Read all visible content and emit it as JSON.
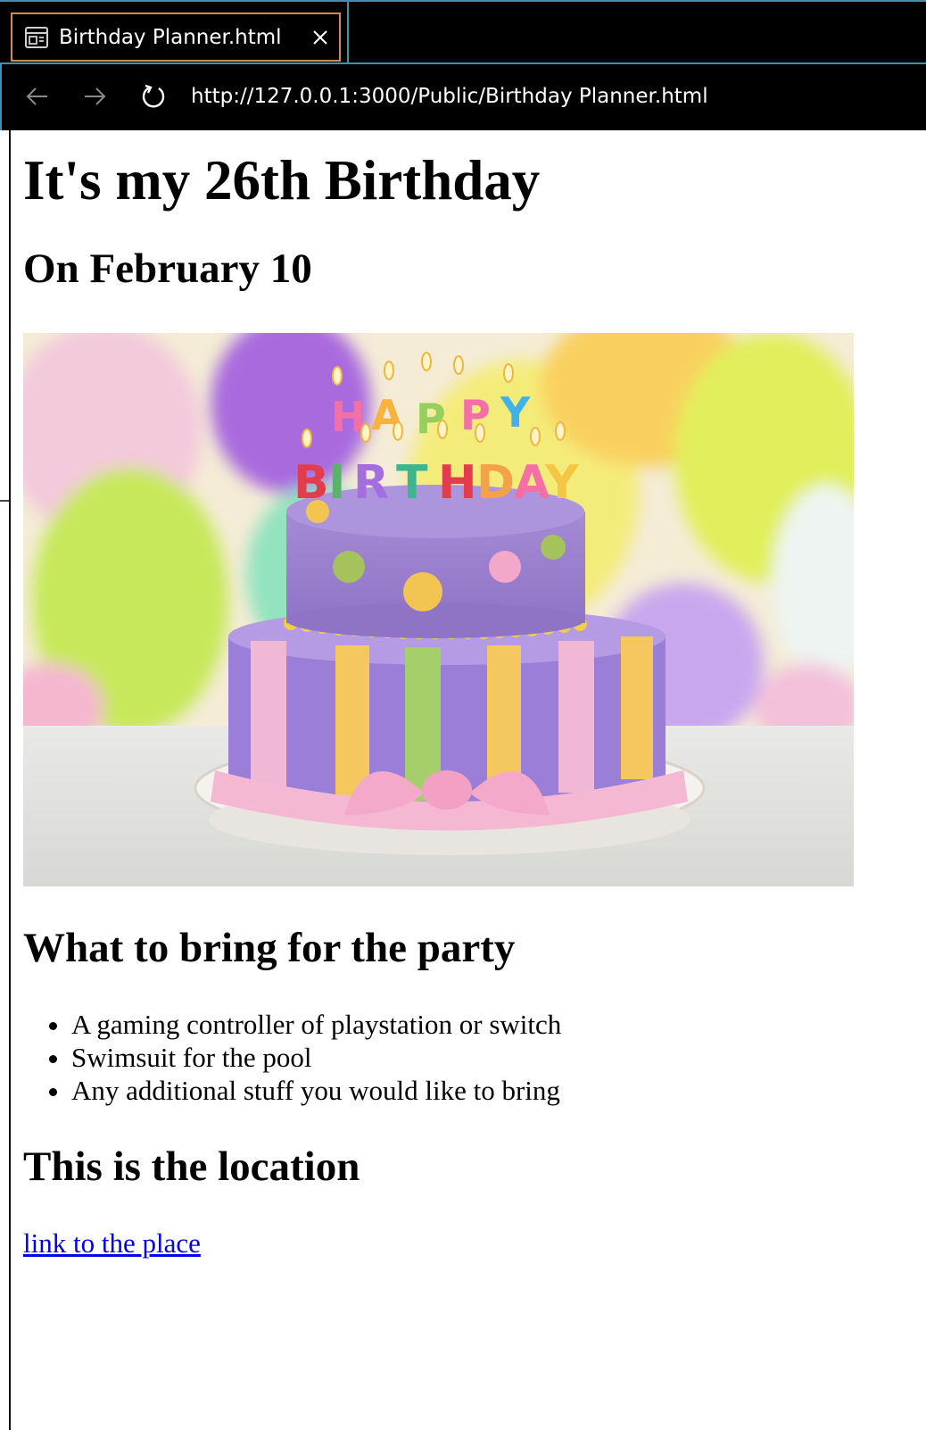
{
  "browser": {
    "tab": {
      "title": "Birthday Planner.html",
      "icon": "page-layout-icon",
      "close_icon": "close-icon"
    },
    "nav": {
      "back_icon": "arrow-left-icon",
      "forward_icon": "arrow-right-icon",
      "reload_icon": "reload-icon",
      "url": "http://127.0.0.1:3000/Public/Birthday Planner.html"
    },
    "colors": {
      "chrome_bg": "#000000",
      "tab_outline": "#d38a4c",
      "frame_accent": "#4a8bb0",
      "link": "#0000ee"
    }
  },
  "page": {
    "heading": "It's my 26th Birthday",
    "date": "On February 10",
    "image": {
      "candle_letters_top": [
        "H",
        "A",
        "P",
        "P",
        "Y"
      ],
      "candle_letters_bottom": [
        "B",
        "I",
        "R",
        "T",
        "H",
        "D",
        "A",
        "Y"
      ]
    },
    "bring_title": "What to bring for the party",
    "bring_items": [
      "A gaming controller of playstation or switch",
      "Swimsuit for the pool",
      "Any additional stuff you would like to bring"
    ],
    "location_title": "This is the location",
    "location_link": "link to the place"
  }
}
